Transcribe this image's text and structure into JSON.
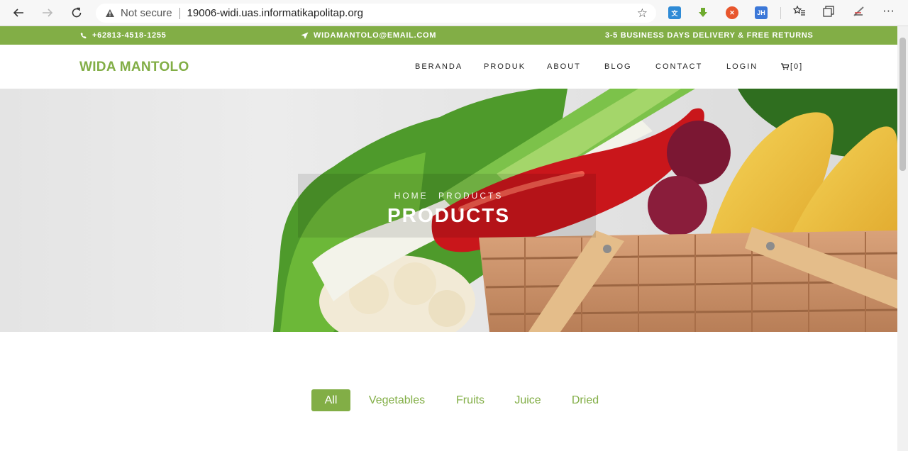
{
  "browser": {
    "security_label": "Not secure",
    "url": "19006-widi.uas.informatikapolitap.org",
    "extensions": [
      {
        "name": "translate",
        "color": "#2f8bd6"
      },
      {
        "name": "download",
        "color": "#6fab2f"
      },
      {
        "name": "record",
        "color": "#e8562d"
      },
      {
        "name": "JH",
        "color": "#3c78d8"
      }
    ]
  },
  "topbar": {
    "phone": "+62813-4518-1255",
    "email": "WIDAMANTOLO@EMAIL.COM",
    "promo": "3-5 BUSINESS DAYS DELIVERY & FREE RETURNS"
  },
  "header": {
    "brand": "WIDA MANTOLO",
    "nav": [
      "BERANDA",
      "PRODUK",
      "ABOUT",
      "BLOG",
      "CONTACT",
      "LOGIN"
    ],
    "cart_count": "[0]"
  },
  "hero": {
    "breadcrumb_home": "HOME",
    "breadcrumb_current": "PRODUCTS",
    "title": "PRODUCTS"
  },
  "filters": [
    "All",
    "Vegetables",
    "Fruits",
    "Juice",
    "Dried"
  ],
  "colors": {
    "accent": "#82ae46"
  }
}
